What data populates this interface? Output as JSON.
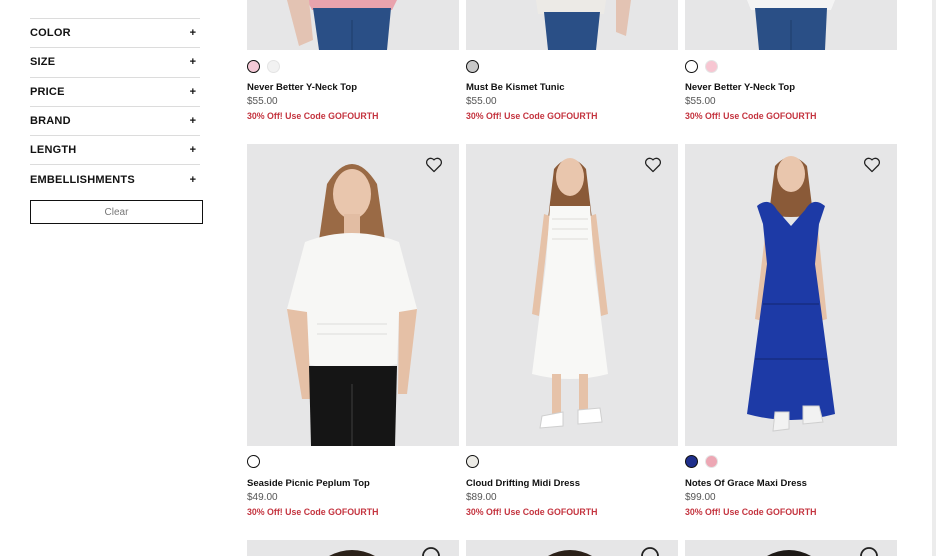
{
  "filters": {
    "items": [
      {
        "label": "COLOR",
        "toggle": "+"
      },
      {
        "label": "SIZE",
        "toggle": "+"
      },
      {
        "label": "PRICE",
        "toggle": "+"
      },
      {
        "label": "BRAND",
        "toggle": "+"
      },
      {
        "label": "LENGTH",
        "toggle": "+"
      },
      {
        "label": "EMBELLISHMENTS",
        "toggle": "+"
      }
    ],
    "clear_label": "Clear"
  },
  "top_row": [
    {
      "name": "Never Better Y-Neck Top",
      "price": "$55.00",
      "promo": "30% Off! Use Code GOFOURTH",
      "swatches": [
        {
          "color": "#f4c9d6",
          "selected": true
        },
        {
          "color": "#f2f2f2",
          "selected": false
        }
      ]
    },
    {
      "name": "Must Be Kismet Tunic",
      "price": "$55.00",
      "promo": "30% Off! Use Code GOFOURTH",
      "swatches": [
        {
          "color": "#c8c8c8",
          "selected": true
        }
      ]
    },
    {
      "name": "Never Better Y-Neck Top",
      "price": "$55.00",
      "promo": "30% Off! Use Code GOFOURTH",
      "swatches": [
        {
          "color": "#ffffff",
          "selected": true
        },
        {
          "color": "#f7c6d2",
          "selected": false
        }
      ]
    }
  ],
  "middle_row": [
    {
      "name": "Seaside Picnic Peplum Top",
      "price": "$49.00",
      "promo": "30% Off! Use Code GOFOURTH",
      "swatches": [
        {
          "color": "#ffffff",
          "selected": true
        }
      ]
    },
    {
      "name": "Cloud Drifting Midi Dress",
      "price": "$89.00",
      "promo": "30% Off! Use Code GOFOURTH",
      "swatches": [
        {
          "color": "#ecebe6",
          "selected": true
        }
      ]
    },
    {
      "name": "Notes Of Grace Maxi Dress",
      "price": "$99.00",
      "promo": "30% Off! Use Code GOFOURTH",
      "swatches": [
        {
          "color": "#1f2f8c",
          "selected": true
        },
        {
          "color": "#eda7b4",
          "selected": false
        }
      ]
    }
  ],
  "colors": {
    "promo": "#c4343f",
    "image_bg": "#e6e6e7",
    "denim": "#2a4f86",
    "dress_blue": "#1d3aa6"
  },
  "icons": {
    "favorite": "heart-icon",
    "expand": "plus-icon"
  }
}
